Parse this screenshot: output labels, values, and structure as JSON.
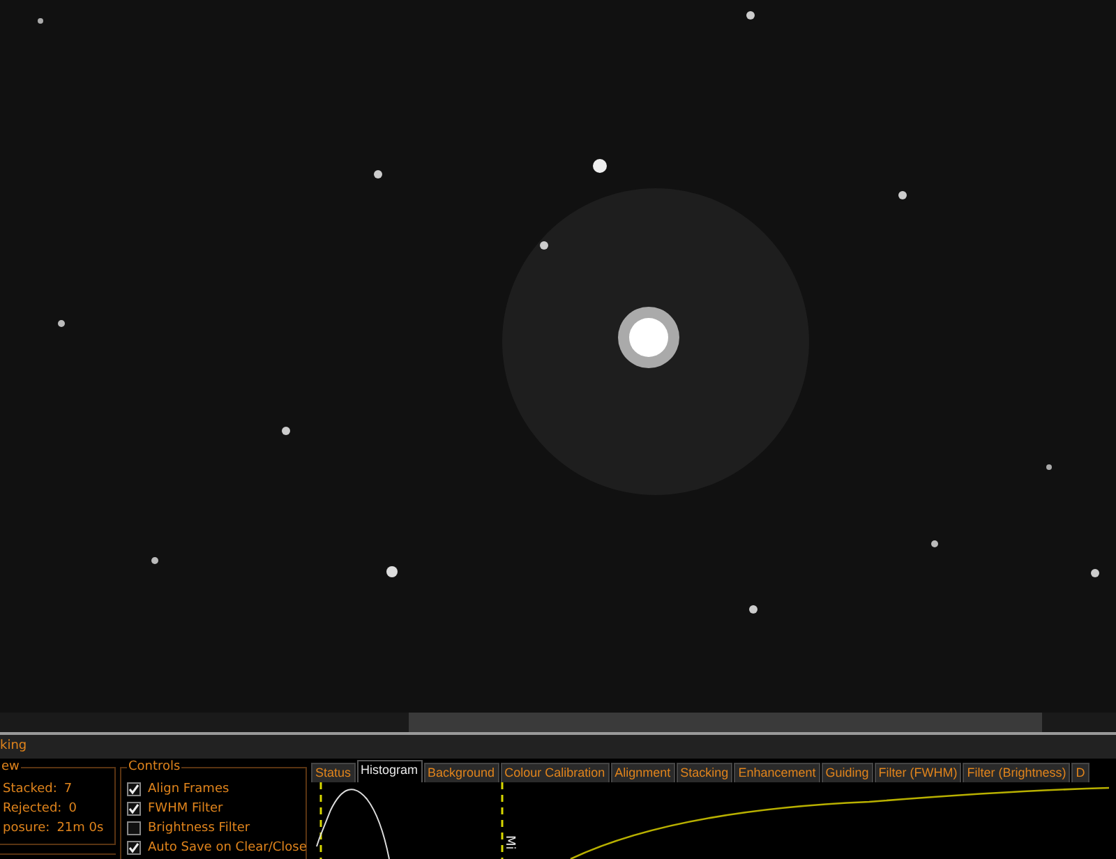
{
  "title": "king",
  "view": {
    "title": "ew",
    "rows": [
      {
        "label": "Stacked:",
        "value": "7"
      },
      {
        "label": "Rejected:",
        "value": "0"
      },
      {
        "label": "posure:",
        "value": "21m 0s"
      }
    ]
  },
  "controls": {
    "title": "Controls",
    "items": [
      {
        "label": "Align Frames",
        "checked": true
      },
      {
        "label": "FWHM Filter",
        "checked": true
      },
      {
        "label": "Brightness Filter",
        "checked": false
      },
      {
        "label": "Auto Save on Clear/Close",
        "checked": true
      }
    ]
  },
  "tabs": [
    {
      "label": "Status",
      "selected": false
    },
    {
      "label": "Histogram",
      "selected": true
    },
    {
      "label": "Background",
      "selected": false
    },
    {
      "label": "Colour Calibration",
      "selected": false
    },
    {
      "label": "Alignment",
      "selected": false
    },
    {
      "label": "Stacking",
      "selected": false
    },
    {
      "label": "Enhancement",
      "selected": false
    },
    {
      "label": "Guiding",
      "selected": false
    },
    {
      "label": "Filter (FWHM)",
      "selected": false
    },
    {
      "label": "Filter (Brightness)",
      "selected": false
    },
    {
      "label": "D",
      "selected": false
    }
  ],
  "histogram": {
    "marker_label": "Mi"
  }
}
